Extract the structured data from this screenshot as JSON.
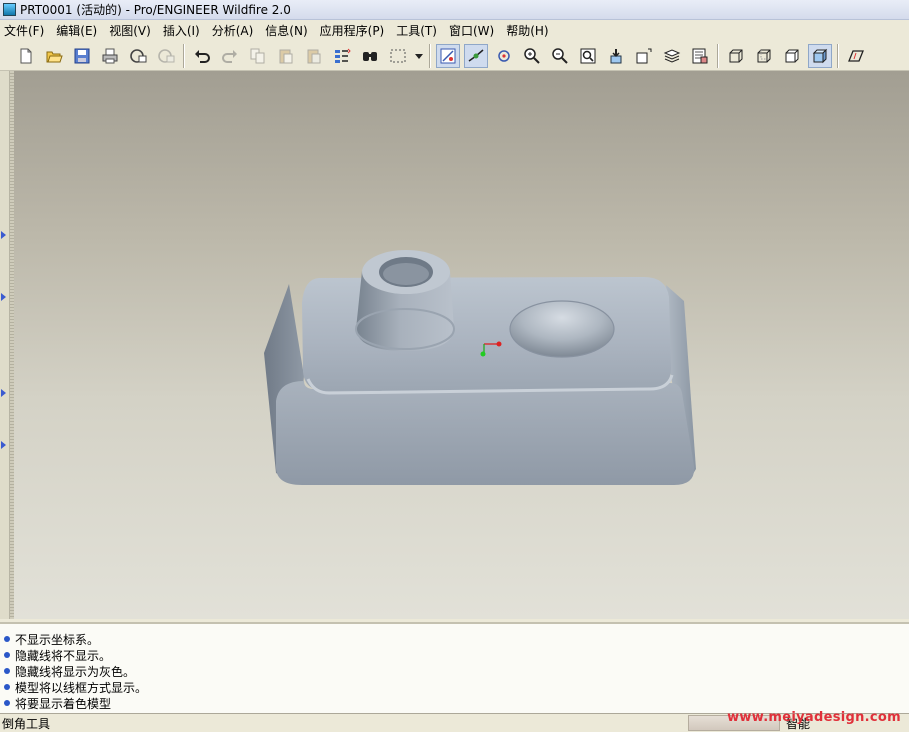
{
  "window": {
    "title": "PRT0001 (活动的) - Pro/ENGINEER Wildfire 2.0"
  },
  "menu": [
    {
      "label": "文件(F)"
    },
    {
      "label": "编辑(E)"
    },
    {
      "label": "视图(V)"
    },
    {
      "label": "插入(I)"
    },
    {
      "label": "分析(A)"
    },
    {
      "label": "信息(N)"
    },
    {
      "label": "应用程序(P)"
    },
    {
      "label": "工具(T)"
    },
    {
      "label": "窗口(W)"
    },
    {
      "label": "帮助(H)"
    }
  ],
  "toolbar_icons": [
    "new-file-icon",
    "open-file-icon",
    "save-icon",
    "print-icon",
    "send-mail-icon",
    "disabled-mail-icon",
    "undo-icon",
    "redo-icon",
    "copy-icon",
    "paste-icon",
    "paste-special-icon",
    "regenerate-icon",
    "find-icon",
    "select-box-icon",
    "datum-display-icon",
    "spin-center-icon",
    "orient-icon",
    "zoom-in-icon",
    "zoom-out-icon",
    "refit-icon",
    "reorient-icon",
    "saved-views-icon",
    "layers-icon",
    "view-manager-icon",
    "wireframe-icon",
    "hidden-line-icon",
    "no-hidden-icon",
    "shading-icon",
    "datum-plane-icon"
  ],
  "messages": [
    {
      "text": "不显示坐标系。"
    },
    {
      "text": "隐藏线将不显示。"
    },
    {
      "text": "隐藏线将显示为灰色。"
    },
    {
      "text": "模型将以线框方式显示。"
    },
    {
      "text": "将要显示着色模型"
    }
  ],
  "status": {
    "tool": "倒角工具",
    "mode": "智能"
  },
  "watermark": "www.meiyadesign.com",
  "colors": {
    "accent": "#2a57c8",
    "model": "#9ea8b3",
    "watermark": "#e0303a"
  }
}
